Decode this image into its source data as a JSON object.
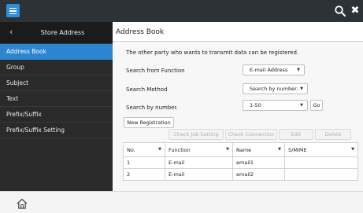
{
  "sidebar": {
    "title": "Store Address",
    "back_icon": "chevron-left-icon",
    "items": [
      {
        "label": "Address Book",
        "active": true
      },
      {
        "label": "Group"
      },
      {
        "label": "Subject"
      },
      {
        "label": "Text"
      },
      {
        "label": "Prefix/Suffix"
      },
      {
        "label": "Prefix/Suffix Setting"
      }
    ]
  },
  "topbar": {
    "menu_icon": "hamburger-menu-icon",
    "search_icon": "search-icon",
    "close_icon": "close-icon",
    "close_glyph": "✖"
  },
  "main": {
    "title": "Address Book",
    "description": "The other party who wants to transmit data can be registered.",
    "search_from_function": {
      "label": "Search from Function",
      "value": "E-mail Address"
    },
    "search_method": {
      "label": "Search Method",
      "value": "Search by number."
    },
    "search_by_number": {
      "label": "Search by number.",
      "value": "1-50",
      "go_label": "Go"
    },
    "buttons": {
      "new_registration": "New Registration",
      "check_job_setting": "Check Job Setting",
      "check_connection": "Check Connection",
      "edit": "Edit",
      "delete": "Delete"
    },
    "table": {
      "headers": [
        "No.",
        "Function",
        "Name",
        "S/MIME"
      ],
      "rows": [
        [
          "1",
          "E-mail",
          "email1",
          ""
        ],
        [
          "2",
          "E-mail",
          "email2",
          ""
        ]
      ]
    }
  },
  "bottombar": {
    "home_icon": "home-icon"
  },
  "colors": {
    "accent": "#2b86cf",
    "topbar": "#2d3237",
    "sidebar": "#2a2a2a"
  }
}
